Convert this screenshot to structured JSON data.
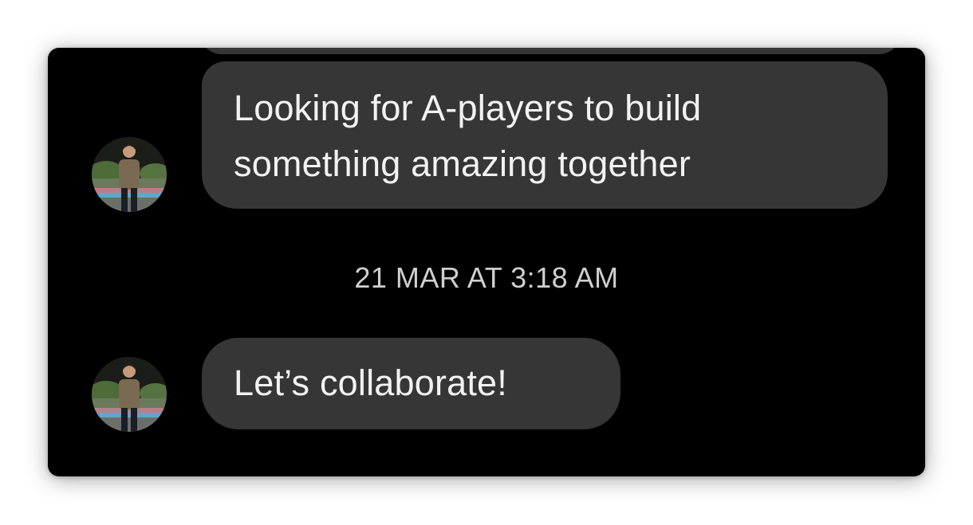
{
  "colors": {
    "background": "#000000",
    "bubble": "#363636",
    "message_text": "#f2f2f2",
    "timestamp_text": "#cfcfcf"
  },
  "messages": [
    {
      "lines": [
        "Looking for A-players to build",
        "something amazing together"
      ],
      "avatar_icon": "profile-photo-icon"
    },
    {
      "lines": [
        "Let’s collaborate!"
      ],
      "avatar_icon": "profile-photo-icon"
    }
  ],
  "timestamp": "21 MAR AT 3:18 AM"
}
